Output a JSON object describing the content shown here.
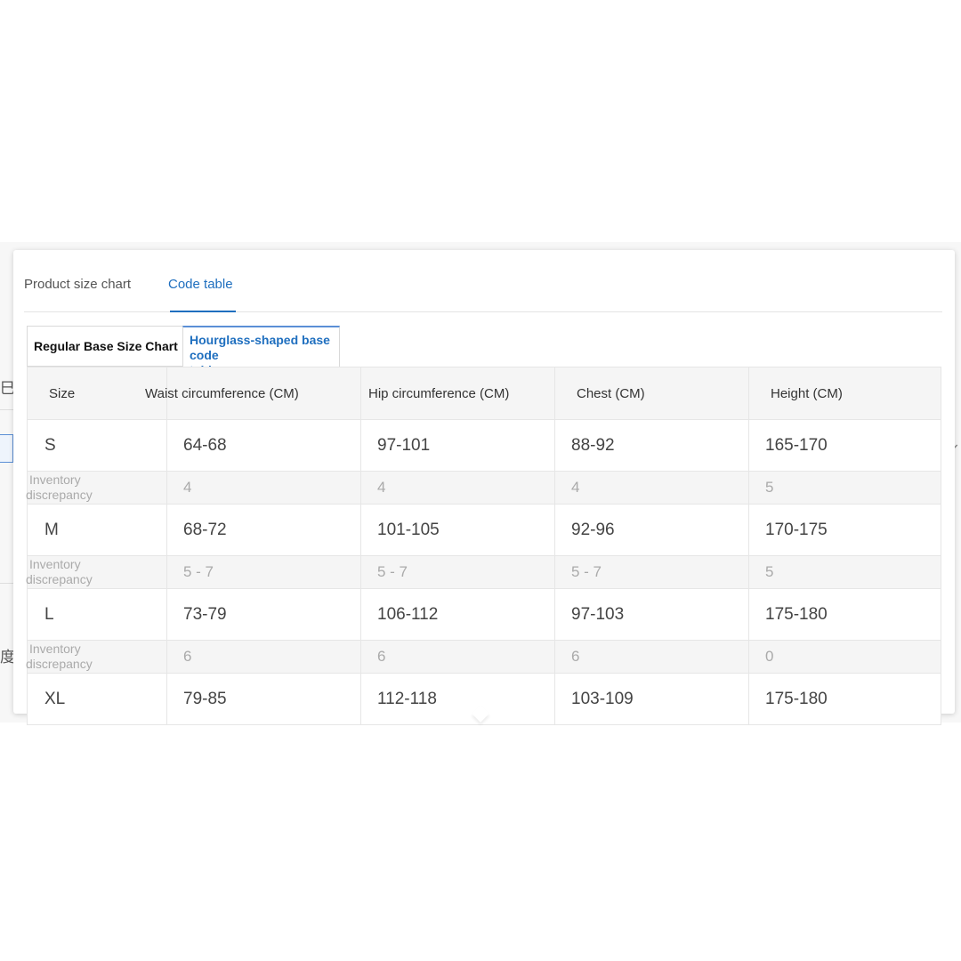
{
  "tabs": [
    "Product size chart",
    "Code table"
  ],
  "active_tab": "Code table",
  "subtabs": [
    "Regular Base Size Chart",
    "Hourglass-shaped base code table"
  ],
  "active_subtab": "Hourglass-shaped base code table",
  "subtab2_lines": [
    "Hourglass-shaped base code",
    "table"
  ],
  "table": {
    "headers": [
      "Size",
      "Waist circumference (CM)",
      "Hip circumference (CM)",
      "Chest (CM)",
      "Height (CM)"
    ],
    "discrepancy_label": [
      "Inventory",
      "discrepancy"
    ],
    "rows": [
      {
        "size": "S",
        "waist": "64-68",
        "hip": "97-101",
        "chest": "88-92",
        "height": "165-170",
        "disc": [
          "4",
          "4",
          "4",
          "5"
        ]
      },
      {
        "size": "M",
        "waist": "68-72",
        "hip": "101-105",
        "chest": "92-96",
        "height": "170-175",
        "disc": [
          "5 - 7",
          "5 - 7",
          "5 - 7",
          "5"
        ]
      },
      {
        "size": "L",
        "waist": "73-79",
        "hip": "106-112",
        "chest": "97-103",
        "height": "175-180",
        "disc": [
          "6",
          "6",
          "6",
          "0"
        ]
      },
      {
        "size": "XL",
        "waist": "79-85",
        "hip": "112-118",
        "chest": "103-109",
        "height": "175-180"
      }
    ]
  },
  "colors": {
    "accent": "#1f6fbf",
    "header_bg": "#f5f5f5",
    "border": "#e6e6e6"
  }
}
